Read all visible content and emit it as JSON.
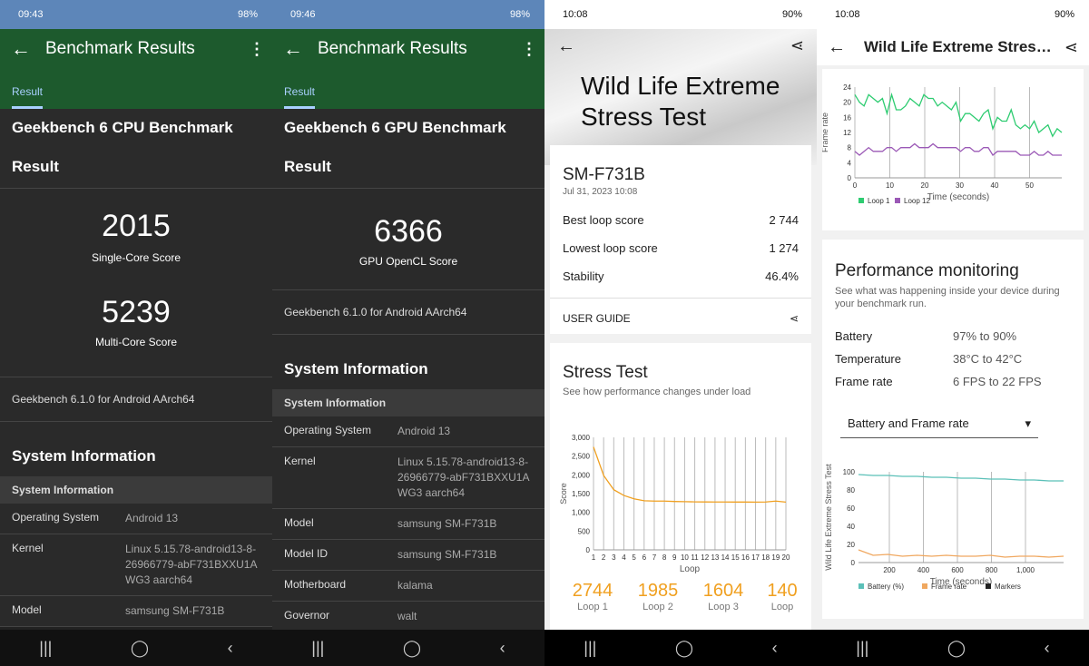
{
  "p1": {
    "time": "09:43",
    "battery": "98%",
    "title": "Benchmark Results",
    "tab": "Result",
    "heading": "Geekbench 6 CPU Benchmark",
    "heading2": "Result",
    "single": "2015",
    "single_label": "Single-Core Score",
    "multi": "5239",
    "multi_label": "Multi-Core Score",
    "version": "Geekbench 6.1.0 for Android AArch64",
    "sys_title": "System Information",
    "sys_sub": "System Information",
    "rows": [
      {
        "k": "Operating System",
        "v": "Android 13"
      },
      {
        "k": "Kernel",
        "v": "Linux 5.15.78-android13-8-26966779-abF731BXXU1AWG3 aarch64"
      },
      {
        "k": "Model",
        "v": "samsung SM-F731B"
      }
    ]
  },
  "p2": {
    "time": "09:46",
    "battery": "98%",
    "title": "Benchmark Results",
    "tab": "Result",
    "heading": "Geekbench 6 GPU Benchmark",
    "heading2": "Result",
    "score": "6366",
    "score_label": "GPU OpenCL Score",
    "version": "Geekbench 6.1.0 for Android AArch64",
    "sys_title": "System Information",
    "sys_sub": "System Information",
    "rows": [
      {
        "k": "Operating System",
        "v": "Android 13"
      },
      {
        "k": "Kernel",
        "v": "Linux 5.15.78-android13-8-26966779-abF731BXXU1AWG3 aarch64"
      },
      {
        "k": "Model",
        "v": "samsung SM-F731B"
      },
      {
        "k": "Model ID",
        "v": "samsung SM-F731B"
      },
      {
        "k": "Motherboard",
        "v": "kalama"
      },
      {
        "k": "Governor",
        "v": "walt"
      }
    ]
  },
  "p3": {
    "time": "10:08",
    "battery": "90%",
    "title_l1": "Wild Life Extreme",
    "title_l2": "Stress Test",
    "device": "SM-F731B",
    "date": "Jul 31, 2023 10:08",
    "best_k": "Best loop score",
    "best_v": "2 744",
    "low_k": "Lowest loop score",
    "low_v": "1 274",
    "stab_k": "Stability",
    "stab_v": "46.4%",
    "guide": "USER GUIDE",
    "st_title": "Stress Test",
    "st_sub": "See how performance changes under load",
    "loops": [
      {
        "n": "2744",
        "l": "Loop 1"
      },
      {
        "n": "1985",
        "l": "Loop 2"
      },
      {
        "n": "1604",
        "l": "Loop 3"
      },
      {
        "n": "140",
        "l": "Loop"
      }
    ]
  },
  "p4": {
    "time": "10:08",
    "battery": "90%",
    "title": "Wild Life Extreme Stress…",
    "pm_title": "Performance monitoring",
    "pm_sub": "See what was happening inside your device during your benchmark run.",
    "rows": [
      {
        "k": "Battery",
        "v": "97% to 90%"
      },
      {
        "k": "Temperature",
        "v": "38°C to 42°C"
      },
      {
        "k": "Frame rate",
        "v": "6 FPS to 22 FPS"
      }
    ],
    "dropdown": "Battery and Frame rate"
  },
  "chart_data": [
    {
      "type": "line",
      "ylabel": "Score",
      "xlabel": "Loop",
      "x": [
        1,
        2,
        3,
        4,
        5,
        6,
        7,
        8,
        9,
        10,
        11,
        12,
        13,
        14,
        15,
        16,
        17,
        18,
        19,
        20
      ],
      "series": [
        {
          "values": [
            2744,
            1985,
            1604,
            1450,
            1360,
            1310,
            1300,
            1300,
            1290,
            1285,
            1280,
            1278,
            1276,
            1276,
            1275,
            1275,
            1274,
            1276,
            1300,
            1274
          ]
        }
      ],
      "ylim": [
        0,
        3000
      ],
      "yticks": [
        "3,000",
        "2,500",
        "2,000",
        "1,500",
        "1,000",
        "500",
        "0"
      ],
      "xticks": [
        "1",
        "2",
        "3",
        "4",
        "5",
        "6",
        "7",
        "8",
        "9",
        "10",
        "11",
        "12",
        "13",
        "14",
        "15",
        "16",
        "17",
        "18",
        "19",
        "20"
      ]
    },
    {
      "type": "line",
      "ylabel": "Frame rate",
      "xlabel": "Time (seconds)",
      "ylim": [
        0,
        24
      ],
      "yticks": [
        "24",
        "20",
        "16",
        "12",
        "8",
        "4",
        "0"
      ],
      "xticks": [
        "0",
        "10",
        "20",
        "30",
        "40",
        "50"
      ],
      "series": [
        {
          "name": "Loop 1",
          "color": "#2ecc71",
          "values": [
            22,
            20,
            19,
            22,
            21,
            20,
            21,
            17,
            22,
            18,
            18,
            19,
            21,
            20,
            19,
            22,
            21,
            21,
            19,
            20,
            19,
            18,
            20,
            15,
            17,
            17,
            16,
            15,
            17,
            18,
            13,
            16,
            15,
            15,
            18,
            14,
            13,
            14,
            13,
            15,
            12,
            13,
            14,
            11,
            13,
            12
          ]
        },
        {
          "name": "Loop 12",
          "color": "#9b59b6",
          "values": [
            7,
            6,
            7,
            8,
            7,
            7,
            7,
            8,
            8,
            7,
            8,
            8,
            8,
            9,
            8,
            8,
            8,
            9,
            8,
            8,
            8,
            8,
            8,
            7,
            8,
            8,
            7,
            7,
            8,
            8,
            6,
            7,
            7,
            7,
            7,
            7,
            6,
            6,
            6,
            7,
            6,
            6,
            7,
            6,
            6,
            6
          ]
        }
      ],
      "legend": [
        "Loop 1",
        "Loop 12"
      ]
    },
    {
      "type": "line",
      "ylabel": "Wild Life Extreme Stress Test",
      "xlabel": "Time (seconds)",
      "ylim": [
        0,
        100
      ],
      "yticks": [
        "100",
        "80",
        "60",
        "40",
        "20",
        "0"
      ],
      "xticks": [
        "200",
        "400",
        "600",
        "800",
        "1,000"
      ],
      "series": [
        {
          "name": "Battery (%)",
          "color": "#5bc0b8",
          "values": [
            97,
            96,
            96,
            95,
            95,
            94,
            94,
            93,
            93,
            92,
            92,
            91,
            91,
            90,
            90
          ]
        },
        {
          "name": "Frame rate",
          "color": "#f0a860",
          "values": [
            14,
            8,
            9,
            7,
            8,
            7,
            8,
            7,
            7,
            8,
            6,
            7,
            7,
            6,
            7
          ]
        },
        {
          "name": "Markers",
          "color": "#222"
        }
      ],
      "legend": [
        "Battery (%)",
        "Frame rate",
        "Markers"
      ]
    }
  ]
}
